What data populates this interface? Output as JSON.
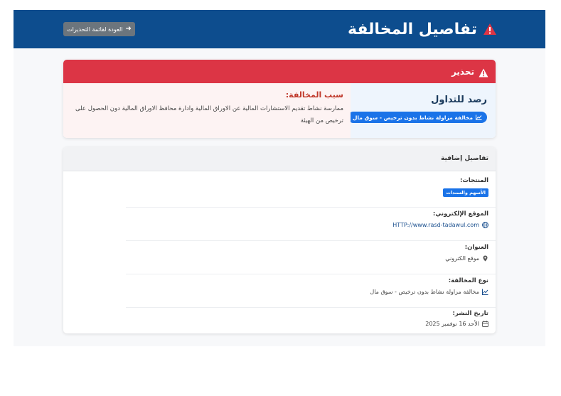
{
  "header": {
    "title": "تفاصيل المخالفة",
    "back_button": "العودة لقائمة التحذيرات"
  },
  "warning": {
    "label": "تحذير",
    "entity_name": "رصد للتداول",
    "violation_badge": "مخالفة مزاولة نشاط بدون ترخيص - سوق مال",
    "reason_title": "سبب المخالفة:",
    "reason_text": "ممارسة نشاط تقديم الاستشارات المالية عن الاوراق المالية وادارة محافظ الاوراق المالية دون الحصول على ترخيص من الهيئة"
  },
  "details": {
    "title": "تفاصيل إضافية",
    "products_label": "المنتجات:",
    "products": [
      "الأسهم والسندات"
    ],
    "website_label": "الموقع الإلكتروني:",
    "website_value": "HTTP://www.rasd-tadawul.com",
    "address_label": "العنوان:",
    "address_value": "موقع الكتروني",
    "violation_type_label": "نوع المخالفة:",
    "violation_type_value": "مخالفة مزاولة نشاط بدون ترخيص - سوق مال",
    "publish_date_label": "تاريخ النشر:",
    "publish_date_value": "الأحد 16 نوفمبر 2025"
  },
  "colors": {
    "header_bg": "#0d4d8e",
    "danger": "#dc3545",
    "primary": "#1a73e8",
    "secondary": "#6c757d"
  },
  "icons": {
    "title": "warning-triangle-icon",
    "back": "arrow-right-icon",
    "badge": "chart-line-icon",
    "website": "globe-icon",
    "address": "map-marker-icon",
    "violation_type": "chart-line-icon",
    "publish_date": "calendar-icon"
  }
}
